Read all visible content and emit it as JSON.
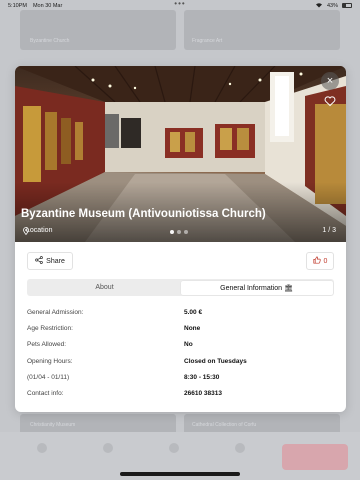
{
  "status_bar": {
    "time": "5:10PM",
    "date": "Mon 30 Mar",
    "battery": "43%",
    "dots": "•••"
  },
  "modal": {
    "title": "Byzantine Museum (Antivouniotissa Church)",
    "location_label": "Location",
    "image_counter": "1 / 3",
    "close_glyph": "×",
    "share_label": "Share",
    "like_count": "0",
    "tabs": [
      {
        "label": "About",
        "active": false
      },
      {
        "label": "General Information 🏛",
        "active": true
      }
    ],
    "info": [
      {
        "label": "General Admission:",
        "value": "5.00 €"
      },
      {
        "label": "Age Restriction:",
        "value": "None"
      },
      {
        "label": "Pets Allowed:",
        "value": "No"
      },
      {
        "label": "Opening Hours:",
        "value": "Closed on Tuesdays"
      },
      {
        "label": "(01/04 - 01/11)",
        "value": "8:30 - 15:30"
      },
      {
        "label": "Contact info:",
        "value": "26610 38313"
      }
    ]
  },
  "background": {
    "card_labels": [
      "Byzantine Church",
      "Fragrance Art",
      "Christianity Museum",
      "Cathedral Collection of Corfu"
    ]
  },
  "colors": {
    "accent": "#c0392b",
    "modal_bg": "#ffffff",
    "backdrop": "#c9cbcf"
  }
}
